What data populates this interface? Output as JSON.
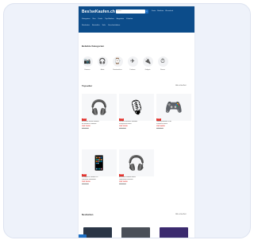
{
  "header": {
    "logo": "Bes!seKaufen.ch",
    "search_placeholder": "Suche...",
    "search_icon": "search-icon",
    "links": [
      "Konto",
      "Merkliste",
      "Warenkorb"
    ],
    "nav_row1": [
      "Kategorien",
      "Neu",
      "Deals",
      "Top-Marken",
      "Angebote",
      "Zubehör"
    ],
    "nav_row2": [
      "Neuheiten",
      "Bestseller",
      "Sale",
      "Geschenkideen"
    ]
  },
  "categories": {
    "title": "Beliebte Kategorien",
    "items": [
      {
        "label": "Kameras",
        "icon": "camera-icon",
        "glyph": "📷"
      },
      {
        "label": "Audio",
        "icon": "headphones-icon",
        "glyph": "🎧"
      },
      {
        "label": "Smartwatches",
        "icon": "watch-icon",
        "glyph": "⌚"
      },
      {
        "label": "Drohnen",
        "icon": "drone-icon",
        "glyph": "✈"
      },
      {
        "label": "Gadgets",
        "icon": "gadget-icon",
        "glyph": "🔌"
      },
      {
        "label": "Fitness",
        "icon": "fitness-icon",
        "glyph": "⏱"
      }
    ]
  },
  "topsellers": {
    "title": "Topseller",
    "more": "Alle ansehen",
    "products": [
      {
        "badge": "-20%",
        "line1": "Bluetooth Stereo Headset",
        "line2": "mit Mikrofon, kabellos",
        "price": "CHF 39.90",
        "old": "CHF 49.90",
        "glyph": "🎧"
      },
      {
        "badge": "-15%",
        "line1": "Wireless Business Headset",
        "line2": "Freisprech-Einheit",
        "price": "CHF 29.90",
        "old": "CHF 34.90",
        "glyph": "🎙"
      },
      {
        "badge": "-25%",
        "line1": "Gaming Headset RGB",
        "line2": "Surround Sound",
        "price": "CHF 44.90",
        "old": "CHF 59.90",
        "glyph": "🎮"
      },
      {
        "badge": "-10%",
        "line1": "Smartphone Gimbal Pro",
        "line2": "3-Achsen Stabilisator",
        "price": "CHF 89.90",
        "old": "CHF 99.90",
        "glyph": "📱"
      },
      {
        "badge": "-30%",
        "line1": "Bluetooth Headset Mono",
        "line2": "Ladestation inklusive",
        "price": "CHF 24.90",
        "old": "CHF 34.90",
        "glyph": "🎧"
      }
    ]
  },
  "neuheiten": {
    "title": "Neuheiten",
    "more": "Alle ansehen"
  }
}
